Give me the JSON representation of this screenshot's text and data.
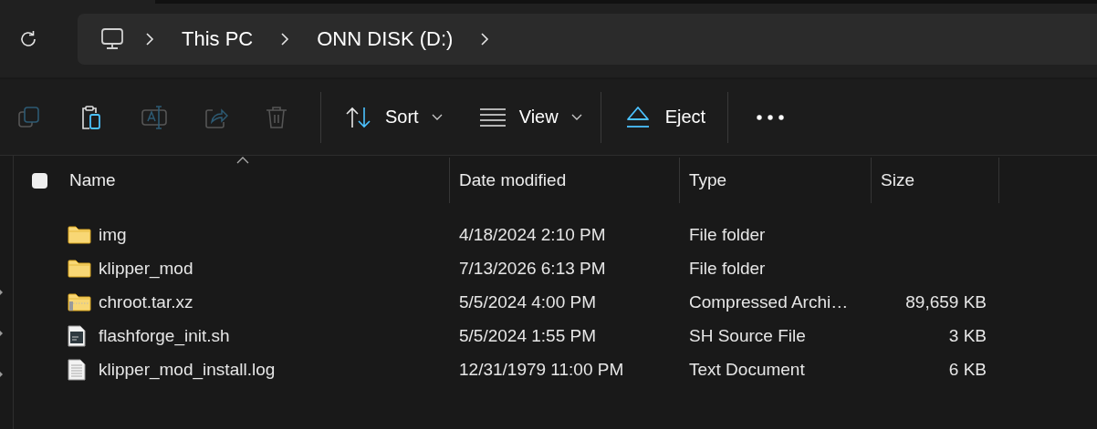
{
  "breadcrumb": [
    {
      "label": "This PC"
    },
    {
      "label": "ONN DISK (D:)"
    }
  ],
  "toolbar": {
    "icon_buttons": [
      {
        "kind": "copy",
        "disabled": true
      },
      {
        "kind": "paste",
        "disabled": false
      },
      {
        "kind": "rename",
        "disabled": true
      },
      {
        "kind": "share",
        "disabled": true
      },
      {
        "kind": "delete",
        "disabled": true
      }
    ],
    "menus": [
      {
        "kind": "sort",
        "label": "Sort"
      },
      {
        "kind": "view",
        "label": "View"
      }
    ],
    "eject": {
      "label": "Eject"
    }
  },
  "table": {
    "select_all_checked": false,
    "columns": [
      "Name",
      "Date modified",
      "Type",
      "Size"
    ],
    "rows": [
      {
        "kind": "folder",
        "name": "img",
        "date": "4/18/2024 2:10 PM",
        "type": "File folder"
      },
      {
        "kind": "folder",
        "name": "klipper_mod",
        "date": "7/13/2026 6:13 PM",
        "type": "File folder"
      },
      {
        "kind": "zip",
        "name": "chroot.tar.xz",
        "date": "5/5/2024 4:00 PM",
        "type": "Compressed Archi…",
        "size": "89,659 KB"
      },
      {
        "kind": "script",
        "name": "flashforge_init.sh",
        "date": "5/5/2024 1:55 PM",
        "type": "SH Source File",
        "size": "3 KB"
      },
      {
        "kind": "text",
        "name": "klipper_mod_install.log",
        "date": "12/31/1979 11:00 PM",
        "type": "Text Document",
        "size": "6 KB"
      }
    ]
  }
}
